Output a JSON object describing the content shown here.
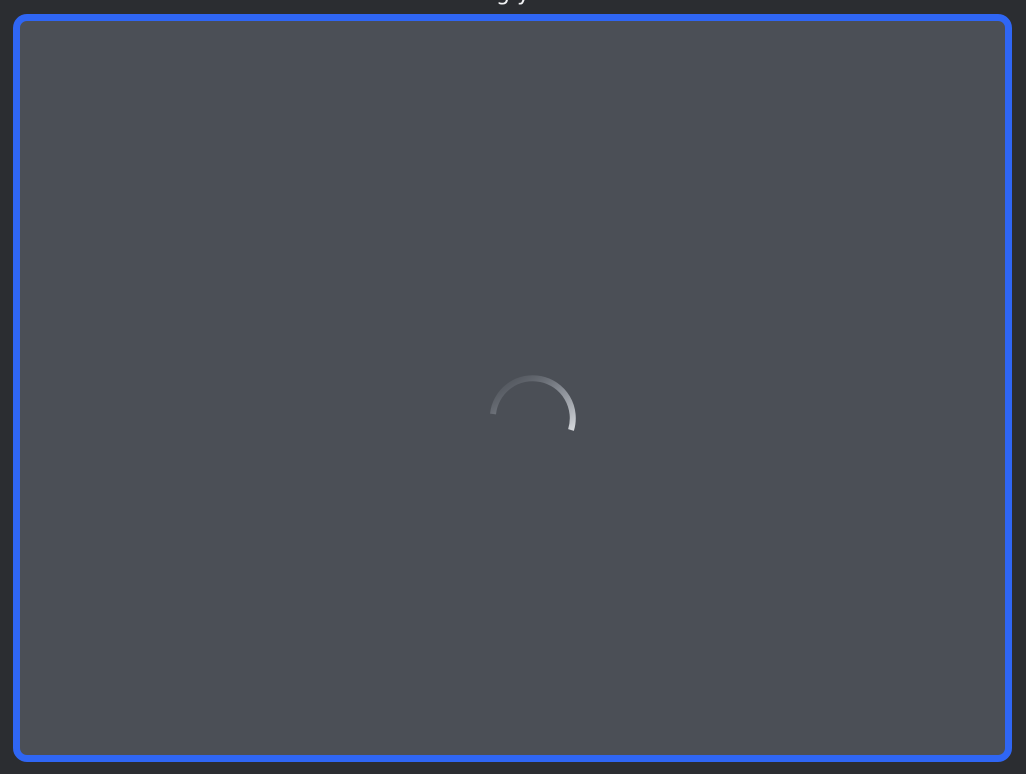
{
  "header": {
    "title": "g y"
  },
  "content": {
    "state": "loading",
    "spinner_icon": "loading-spinner-icon"
  },
  "colors": {
    "frame_border": "#2f66f4",
    "content_background": "#4b4f56",
    "page_background": "#2b2d31",
    "spinner": "#c8cbd0"
  }
}
